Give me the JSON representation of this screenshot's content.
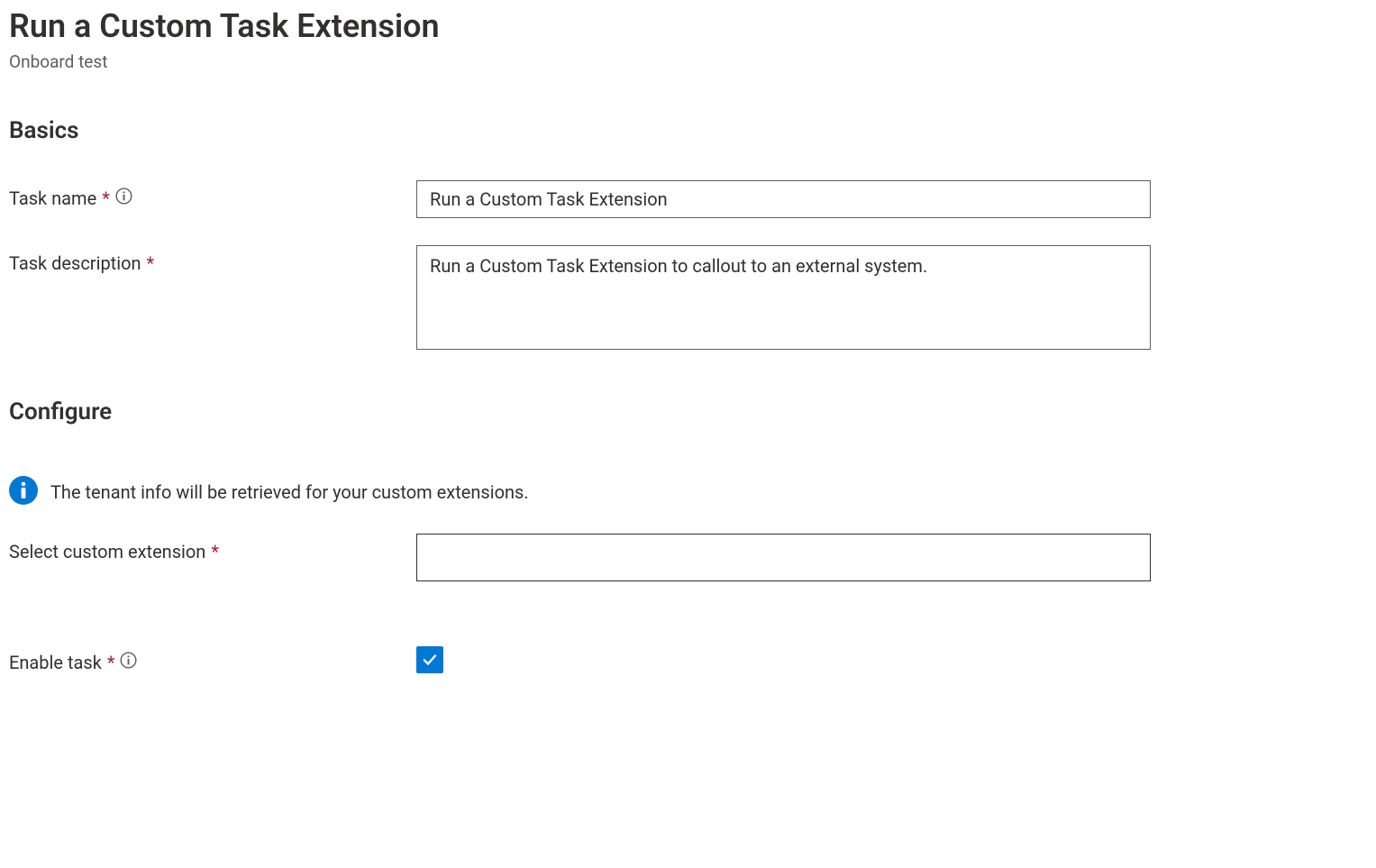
{
  "header": {
    "title": "Run a Custom Task Extension",
    "subtitle": "Onboard test"
  },
  "sections": {
    "basics": {
      "heading": "Basics",
      "task_name_label": "Task name",
      "task_name_value": "Run a Custom Task Extension",
      "task_description_label": "Task description",
      "task_description_value": "Run a Custom Task Extension to callout to an external system."
    },
    "configure": {
      "heading": "Configure",
      "info_text": "The tenant info will be retrieved for your custom extensions.",
      "select_extension_label": "Select custom extension",
      "select_extension_value": "",
      "enable_task_label": "Enable task",
      "enable_task_checked": true
    }
  },
  "required_marker": "*"
}
